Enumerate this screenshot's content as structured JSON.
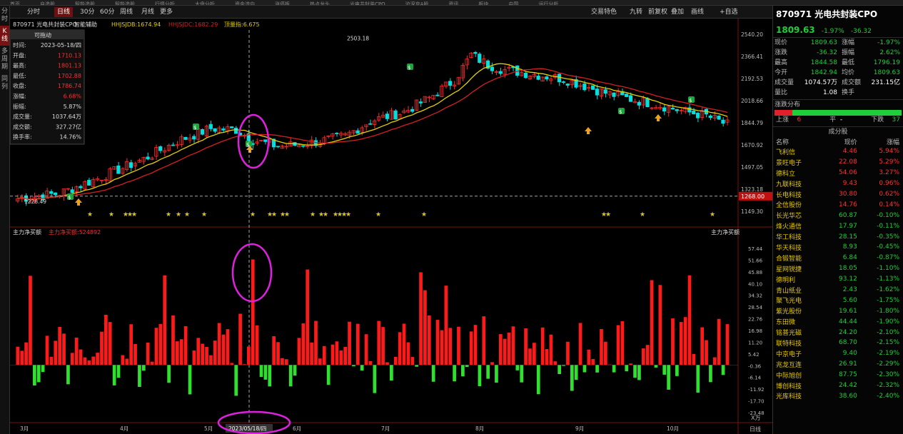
{
  "top_tabs": [
    "首页",
    "自选股",
    "智能选股",
    "智能选股",
    "行情分析",
    "大盘分析",
    "资金流向",
    "涨停板",
    "热点龙头",
    "光电共封装CPO",
    "沪深京A股",
    "资讯",
    "板块",
    "中国",
    "运行分析"
  ],
  "left_rail": [
    "分时",
    "K线",
    "多周期",
    "同列"
  ],
  "toolbar": {
    "left": [
      "分时",
      "日线",
      "30分",
      "60分",
      "周线",
      "月线",
      "更多"
    ],
    "active": "日线",
    "right": [
      "交易特色",
      "九转",
      "前复权",
      "叠加",
      "画线",
      "+自选"
    ]
  },
  "chart": {
    "info": {
      "code_name": "870971 光电共封装CPO",
      "indicator_menu": "智能辅助",
      "hhjsjdb": "HHJSJDB:1674.94",
      "hhjsjdc": "HHJSJDC:1682.29",
      "indicator3": "顶量指:6.675"
    },
    "tooltip": {
      "title": "可拖动",
      "rows": [
        [
          "时间:",
          "2023-05-18/四"
        ],
        [
          "开盘:",
          "1710.13"
        ],
        [
          "最高:",
          "1801.13"
        ],
        [
          "最低:",
          "1702.88"
        ],
        [
          "收盘:",
          "1786.74"
        ],
        [
          "涨幅:",
          "6.68%"
        ],
        [
          "振幅:",
          "5.87%"
        ],
        [
          "成交量:",
          "1037.64万"
        ],
        [
          "成交额:",
          "327.27亿"
        ],
        [
          "换手率:",
          "14.76%"
        ]
      ]
    },
    "y_ticks": [
      "2540.20",
      "2366.41",
      "2192.53",
      "2018.66",
      "1844.79",
      "1670.92",
      "1497.05",
      "1323.18",
      "1149.30"
    ],
    "current_price_label": "1268.00",
    "max_label": "2503.18",
    "min_label": "1228.49",
    "lower_title": "主力净买额",
    "lower_value": "主力净买额:524892",
    "lower_right_label": "主力净买额",
    "lower_y_ticks": [
      "57.44",
      "51.66",
      "45.88",
      "40.10",
      "34.32",
      "28.54",
      "22.76",
      "16.98",
      "11.20",
      "5.42",
      "-0.36",
      "-6.14",
      "-11.92",
      "-17.70",
      "-23.48"
    ],
    "lower_unit": "X万",
    "x_labels": [
      "3月",
      "4月",
      "5月",
      "6月",
      "7月",
      "8月",
      "9月",
      "10月"
    ],
    "cursor_date": "2023/05/18/四",
    "right_corner": "日线",
    "colors": {
      "up": "#ff2a2a",
      "down": "#00e0e0",
      "ma_yellow": "#e6d200",
      "ma_red": "#d42020",
      "flow_up": "#ff1a1a",
      "flow_down": "#2fe02f",
      "highlight": "#e020e0"
    }
  },
  "quote": {
    "title": "870971 光电共封装CPO",
    "price": "1809.63",
    "chg_pct": "-1.97%",
    "chg": "-36.32",
    "rows": [
      [
        "现价",
        "1809.63",
        "涨幅",
        "-1.97%"
      ],
      [
        "涨跌",
        "-36.32",
        "振幅",
        "2.62%"
      ],
      [
        "最高",
        "1844.58",
        "最低",
        "1796.19"
      ],
      [
        "今开",
        "1842.94",
        "均价",
        "1809.63"
      ],
      [
        "成交量",
        "1074.57万",
        "成交额",
        "231.15亿"
      ],
      [
        "量比",
        "1.08",
        "换手",
        ""
      ]
    ],
    "dist_title": "涨跌分布",
    "up_label": "上涨",
    "up_n": "6",
    "flat_label": "平",
    "flat_n": "-",
    "down_label": "下跌",
    "down_n": "37",
    "cons_title": "成分股",
    "cons_headers": [
      "名称",
      "现价",
      "涨幅"
    ],
    "constituents": [
      [
        "飞利信",
        "4.46",
        "5.94%"
      ],
      [
        "景旺电子",
        "22.08",
        "5.29%"
      ],
      [
        "德科立",
        "54.06",
        "3.27%"
      ],
      [
        "九联科技",
        "9.43",
        "0.96%"
      ],
      [
        "长电科技",
        "30.80",
        "0.62%"
      ],
      [
        "全信股份",
        "14.76",
        "0.14%"
      ],
      [
        "长光华芯",
        "60.87",
        "-0.10%"
      ],
      [
        "烽火通信",
        "17.97",
        "-0.11%"
      ],
      [
        "华工科技",
        "28.15",
        "-0.35%"
      ],
      [
        "华天科技",
        "8.93",
        "-0.45%"
      ],
      [
        "合锻智能",
        "6.84",
        "-0.87%"
      ],
      [
        "星网锐捷",
        "18.05",
        "-1.10%"
      ],
      [
        "德明利",
        "93.12",
        "-1.13%"
      ],
      [
        "青山纸业",
        "2.43",
        "-1.62%"
      ],
      [
        "聚飞光电",
        "5.60",
        "-1.75%"
      ],
      [
        "紫光股份",
        "19.61",
        "-1.80%"
      ],
      [
        "东田微",
        "44.44",
        "-1.90%"
      ],
      [
        "铭普光磁",
        "24.20",
        "-2.10%"
      ],
      [
        "联特科技",
        "68.70",
        "-2.15%"
      ],
      [
        "中京电子",
        "9.40",
        "-2.19%"
      ],
      [
        "兆龙互连",
        "26.91",
        "-2.29%"
      ],
      [
        "中际旭创",
        "87.75",
        "-2.30%"
      ],
      [
        "博创科技",
        "24.42",
        "-2.32%"
      ],
      [
        "光库科技",
        "38.60",
        "-2.40%"
      ]
    ]
  }
}
